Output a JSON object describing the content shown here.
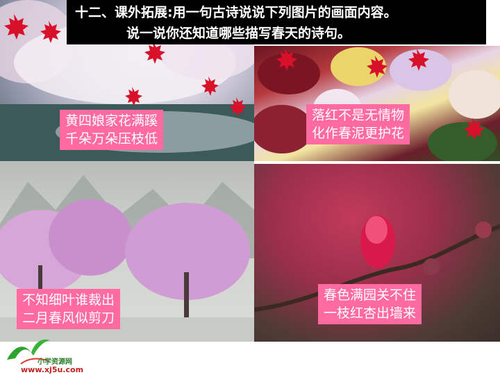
{
  "title": {
    "line1": "十二、课外拓展:用一句古诗说说下列图片的画面内容。",
    "line2": "说一说你还知道哪些描写春天的诗句。"
  },
  "panels": {
    "top_left_caption": [
      "黄四娘家花满蹊",
      "千朵万朵压枝低"
    ],
    "top_right_caption": [
      "落红不是无情物",
      "化作春泥更护花"
    ],
    "bottom_left_caption": [
      "不知细叶谁裁出",
      "二月春风似剪刀"
    ],
    "bottom_right_caption": [
      "春色满园关不住",
      "一枝红杏出墙来"
    ]
  },
  "footer": {
    "logo_text": "小学资源网",
    "logo_url": "www.xj5u.com"
  },
  "colors": {
    "caption_bg": "#ff6ba0",
    "title_bg": "#000000",
    "leaf_red": "#d8102a"
  }
}
